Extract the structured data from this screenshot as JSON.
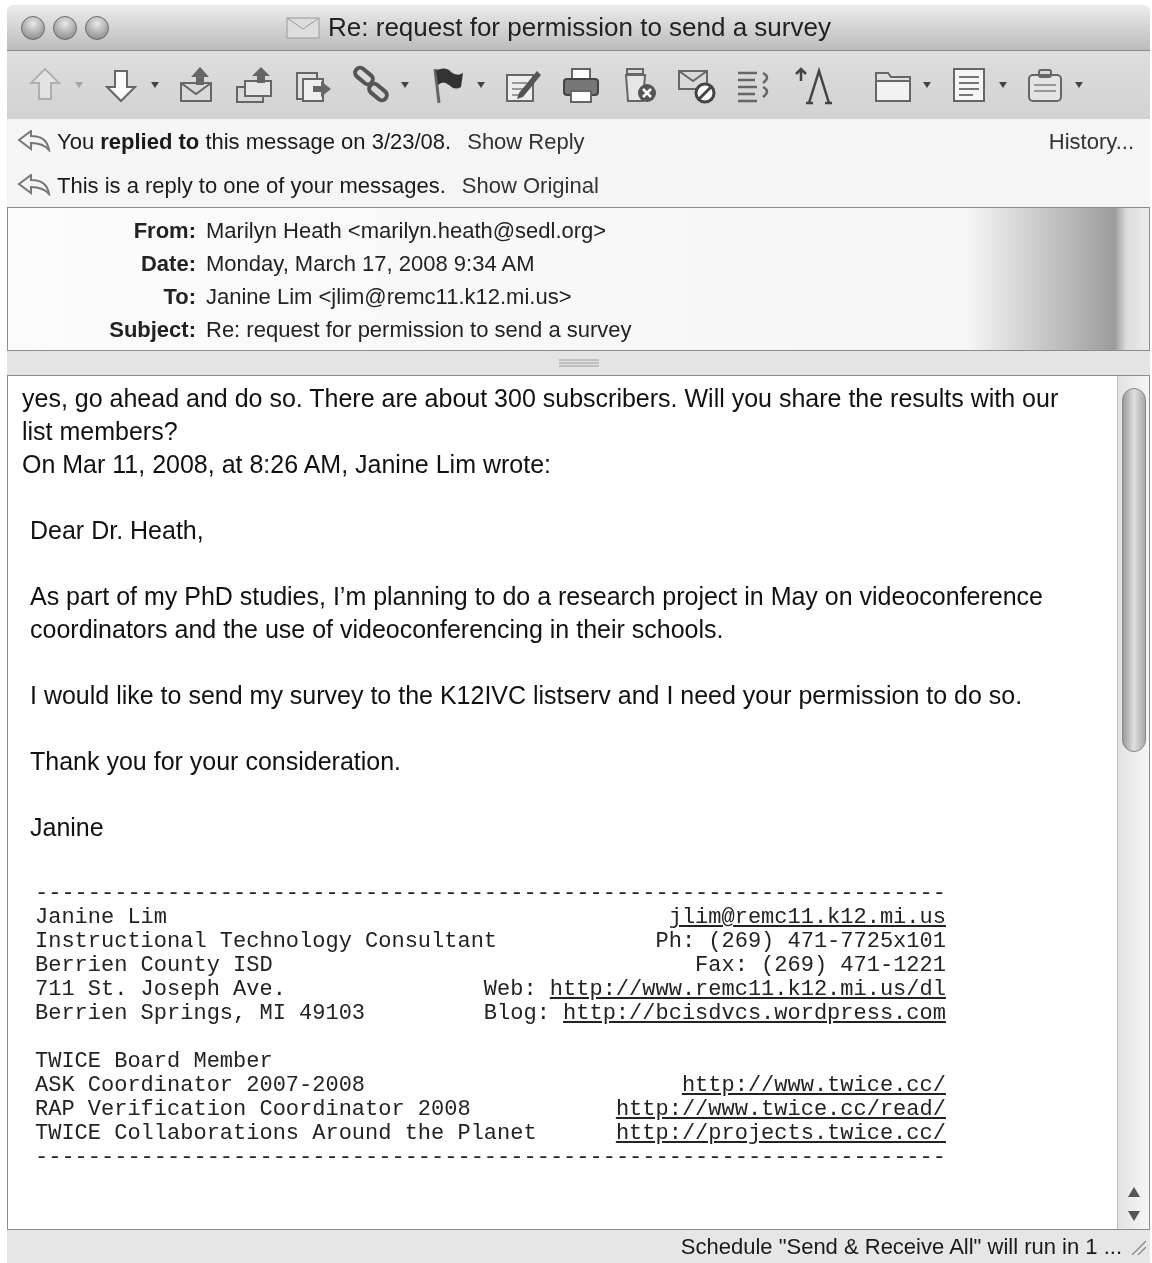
{
  "window": {
    "title": "Re: request for permission to send a survey"
  },
  "toolbar": [
    {
      "disabled": true,
      "dropdown": true
    },
    {
      "disabled": false,
      "dropdown": true
    },
    {
      "disabled": false,
      "dropdown": false
    },
    {
      "disabled": false,
      "dropdown": false
    },
    {
      "disabled": false,
      "dropdown": false
    },
    {
      "disabled": false,
      "dropdown": true
    },
    {
      "disabled": false,
      "dropdown": true
    },
    {
      "disabled": false,
      "dropdown": false
    },
    {
      "disabled": false,
      "dropdown": false
    },
    {
      "disabled": false,
      "dropdown": false
    },
    {
      "disabled": false,
      "dropdown": false
    },
    {
      "disabled": false,
      "dropdown": false
    },
    {
      "disabled": false,
      "dropdown": false
    },
    {
      "disabled": false,
      "dropdown": true
    },
    {
      "disabled": false,
      "dropdown": true
    },
    {
      "disabled": false,
      "dropdown": true
    }
  ],
  "info_bars": [
    {
      "text": "You **replied to** this message on 3/23/08.",
      "link": "Show Reply",
      "history": "History..."
    },
    {
      "text": "This is a reply to one of your messages.",
      "link": "Show Original"
    }
  ],
  "header": {
    "fields": [
      {
        "label": "From:",
        "value": "Marilyn Heath <marilyn.heath@sedl.org>"
      },
      {
        "label": "Date:",
        "value": "Monday, March 17, 2008 9:34 AM"
      },
      {
        "label": "To:",
        "value": "Janine Lim <jlim@remc11.k12.mi.us>"
      },
      {
        "label": "Subject:",
        "value": "Re: request for permission to send a survey"
      }
    ]
  },
  "body": {
    "reply": [
      "yes, go ahead and do so. There are about 300 subscribers. Will you share the results with our list members?",
      "On Mar 11, 2008, at 8:26 AM, Janine Lim wrote:"
    ],
    "quoted": [
      "Dear Dr. Heath,",
      "As part of my PhD studies, I’m planning to do a research project in May on videoconference coordinators and the use of videoconferencing in their schools.",
      "I would like to send my survey to the K12IVC listserv and I need your permission to do so.",
      "Thank you for your consideration.",
      "Janine"
    ],
    "signature": {
      "top_rule": "---------------------------------------------------------------------",
      "groups": [
        [
          {
            "left": "Janine Lim",
            "link": "jlim@remc11.k12.mi.us"
          },
          {
            "left": "Instructional Technology Consultant",
            "right": "Ph: (269) 471-7725x101"
          },
          {
            "left": "Berrien County ISD",
            "right": "Fax: (269) 471-1221"
          },
          {
            "left": "711 St. Joseph Ave.",
            "right": "Web:",
            "link": "http://www.remc11.k12.mi.us/dl"
          },
          {
            "left": "Berrien Springs, MI 49103",
            "right": "Blog:",
            "link": "http://bcisdvcs.wordpress.com"
          }
        ],
        [
          {
            "left": "TWICE Board Member"
          },
          {
            "left": "ASK Coordinator 2007-2008",
            "link": "http://www.twice.cc/"
          },
          {
            "left": "RAP Verification Coordinator 2008",
            "link": "http://www.twice.cc/read/"
          },
          {
            "left": "TWICE Collaborations Around the Planet",
            "link": "http://projects.twice.cc/"
          }
        ]
      ],
      "bottom_rule": "---------------------------------------------------------------------"
    }
  },
  "status_bar": {
    "text": "Schedule \"Send & Receive All\" will run in 1 ..."
  }
}
